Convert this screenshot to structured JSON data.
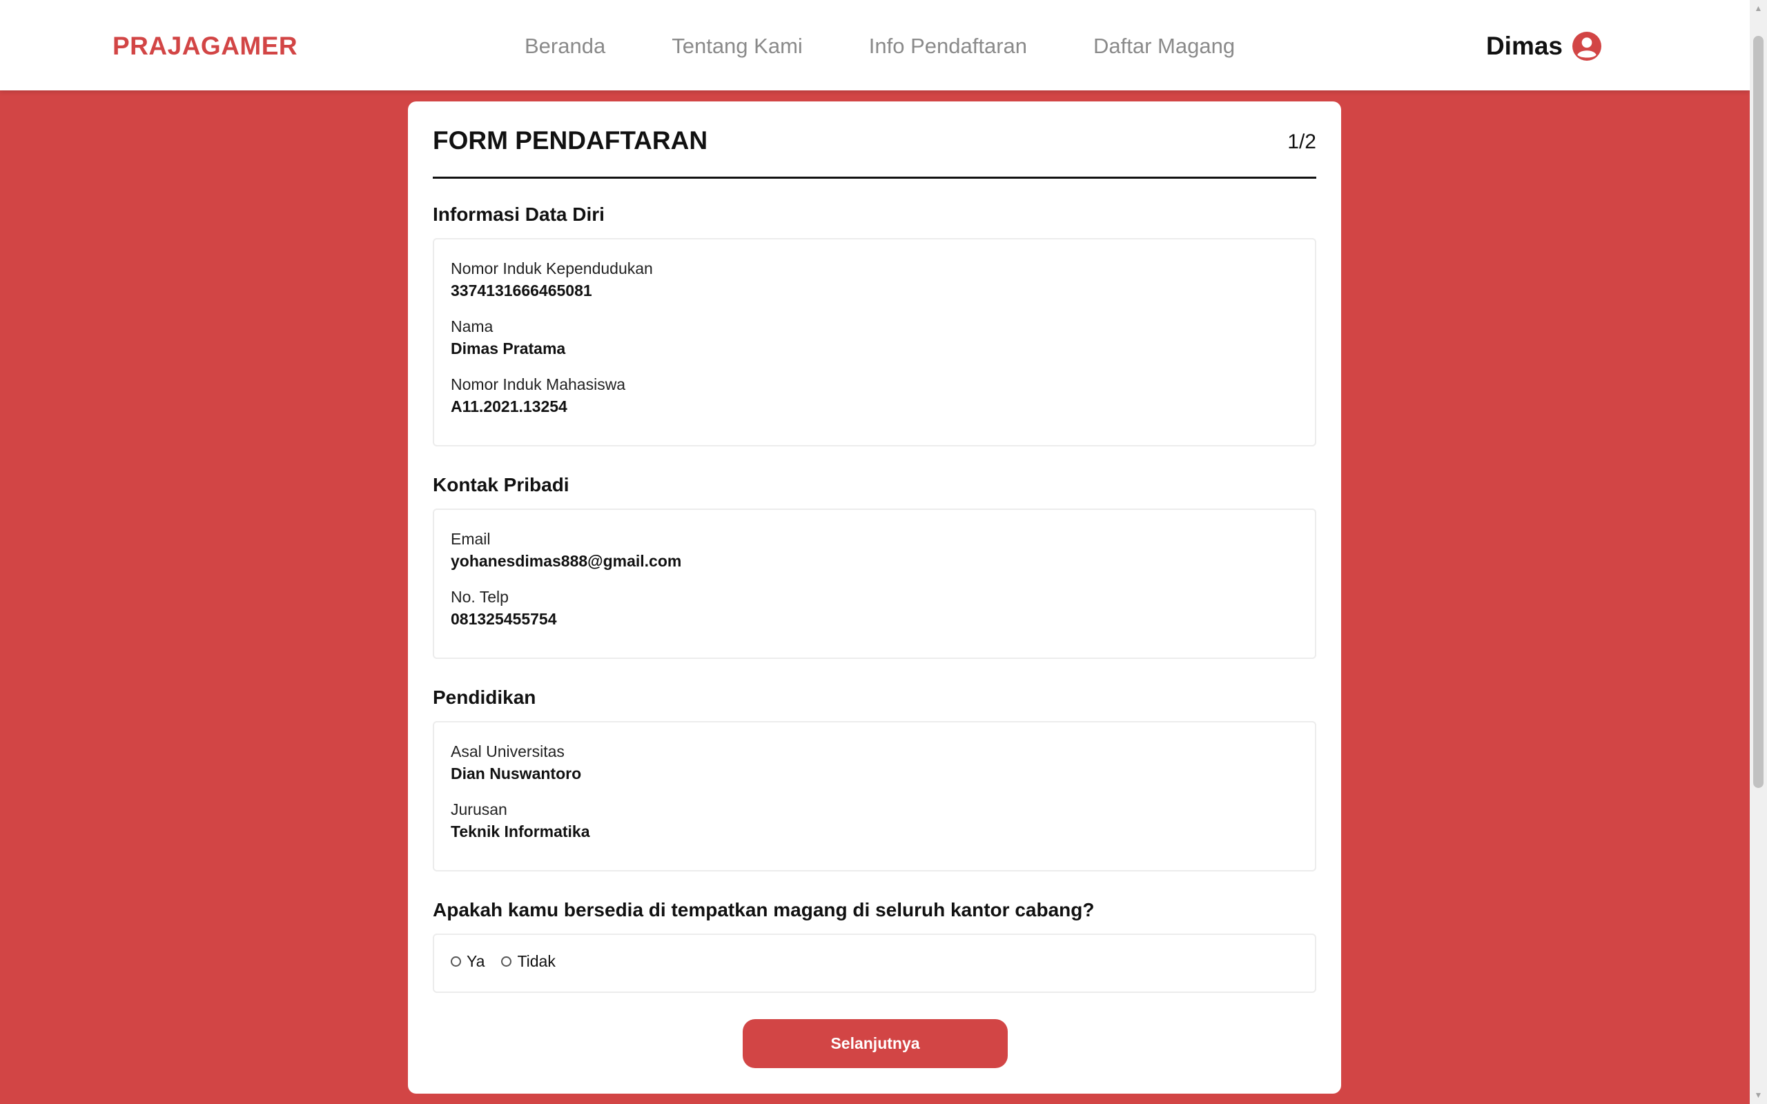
{
  "nav": {
    "brand": "PRAJAGAMER",
    "links": [
      "Beranda",
      "Tentang Kami",
      "Info Pendaftaran",
      "Daftar Magang"
    ],
    "user_name": "Dimas",
    "user_icon": "user-circle-icon"
  },
  "form": {
    "title": "FORM PENDAFTARAN",
    "step": "1/2",
    "sections": {
      "personal": {
        "title": "Informasi Data Diri",
        "fields": [
          {
            "label": "Nomor Induk Kependudukan",
            "value": "3374131666465081"
          },
          {
            "label": "Nama",
            "value": "Dimas Pratama"
          },
          {
            "label": "Nomor Induk Mahasiswa",
            "value": "A11.2021.13254"
          }
        ]
      },
      "contact": {
        "title": "Kontak Pribadi",
        "fields": [
          {
            "label": "Email",
            "value": "yohanesdimas888@gmail.com"
          },
          {
            "label": "No. Telp",
            "value": "081325455754"
          }
        ]
      },
      "education": {
        "title": "Pendidikan",
        "fields": [
          {
            "label": "Asal Universitas",
            "value": "Dian Nuswantoro"
          },
          {
            "label": "Jurusan",
            "value": "Teknik Informatika"
          }
        ]
      }
    },
    "question": {
      "text": "Apakah kamu bersedia di tempatkan magang di seluruh kantor cabang?",
      "options": [
        "Ya",
        "Tidak"
      ]
    },
    "next_label": "Selanjutnya"
  },
  "colors": {
    "accent": "#d24545",
    "background": "#d24545",
    "card": "#ffffff"
  }
}
